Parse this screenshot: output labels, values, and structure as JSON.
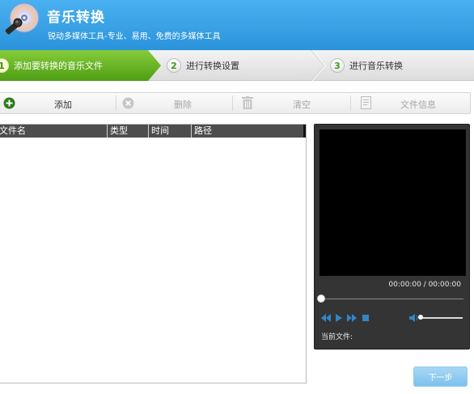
{
  "header": {
    "title": "音乐转换",
    "subtitle": "锐动多媒体工具-专业、易用、免费的多媒体工具"
  },
  "steps": [
    {
      "number": "1",
      "label": "添加要转换的音乐文件"
    },
    {
      "number": "2",
      "label": "进行转换设置"
    },
    {
      "number": "3",
      "label": "进行音乐转换"
    }
  ],
  "toolbar": {
    "add_label": "添加",
    "delete_label": "删除",
    "clear_label": "清空",
    "info_label": "文件信息"
  },
  "file_list": {
    "columns": [
      "文件名",
      "类型",
      "时间",
      "路径"
    ]
  },
  "player": {
    "time_display": "00:00:00 / 00:00:00",
    "current_file_label": "当前文件:"
  },
  "next_label": "下一步",
  "colors": {
    "header_blue": "#2b93da",
    "active_step_green": "#5fb21c",
    "add_icon_green": "#2d7d1a"
  }
}
